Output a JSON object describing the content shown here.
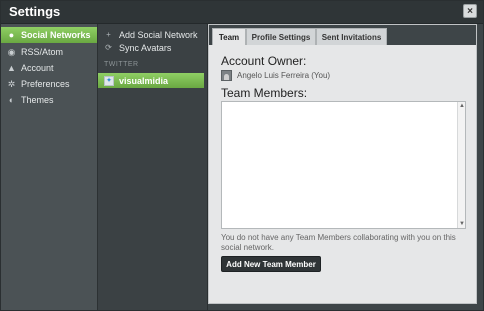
{
  "window": {
    "title": "Settings",
    "close_label": "×"
  },
  "leftnav": {
    "items": [
      {
        "label": "Social Networks",
        "active": true,
        "icon": "users-icon"
      },
      {
        "label": "RSS/Atom",
        "active": false,
        "icon": "rss-icon"
      },
      {
        "label": "Account",
        "active": false,
        "icon": "account-icon"
      },
      {
        "label": "Preferences",
        "active": false,
        "icon": "gear-icon"
      },
      {
        "label": "Themes",
        "active": false,
        "icon": "palette-icon"
      }
    ]
  },
  "midcol": {
    "add_label": "Add Social Network",
    "sync_label": "Sync Avatars",
    "section": "TWITTER",
    "account": "visualmidia"
  },
  "tabs": [
    {
      "label": "Team",
      "active": true
    },
    {
      "label": "Profile Settings",
      "active": false
    },
    {
      "label": "Sent Invitations",
      "active": false
    }
  ],
  "team": {
    "owner_heading": "Account Owner:",
    "owner_name": "Angelo Luis Ferreira (You)",
    "members_heading": "Team Members:",
    "empty_message": "You do not have any Team Members collaborating with you on this social network.",
    "add_button": "Add New Team Member"
  }
}
